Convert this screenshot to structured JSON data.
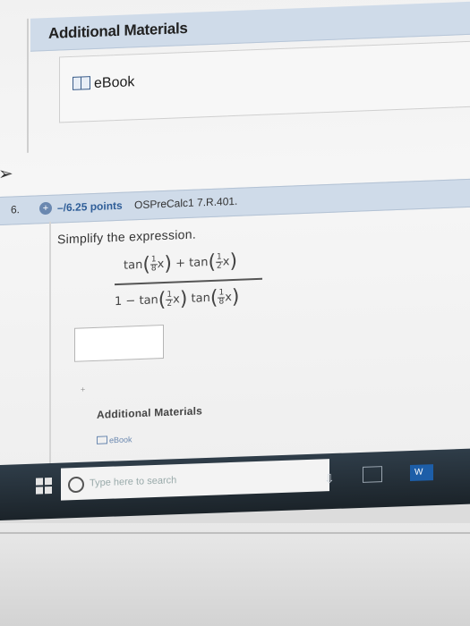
{
  "additional_materials_top": {
    "heading": "Additional Materials",
    "ebook_label": "eBook"
  },
  "question": {
    "number": "6.",
    "points": "–/6.25 points",
    "source": "OSPreCalc1 7.R.401.",
    "prompt": "Simplify the expression.",
    "expression": {
      "num_tan1": "tan",
      "num_frac1": {
        "n": "1",
        "d": "8"
      },
      "plus": "+",
      "num_tan2": "tan",
      "num_frac2": {
        "n": "1",
        "d": "2"
      },
      "den_one": "1",
      "minus": "−",
      "den_tan1": "tan",
      "den_frac1": {
        "n": "1",
        "d": "2"
      },
      "den_tan2": "tan",
      "den_frac2": {
        "n": "1",
        "d": "8"
      },
      "variable": "x"
    },
    "answer_value": ""
  },
  "additional_materials_bottom": {
    "heading": "Additional Materials",
    "ebook_label": "eBook"
  },
  "taskbar": {
    "search_placeholder": "Type here to search",
    "app_label": "W"
  }
}
